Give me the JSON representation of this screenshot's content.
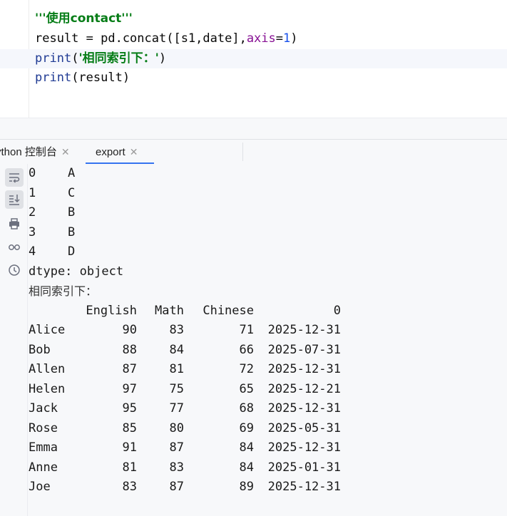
{
  "editor": {
    "lines": [
      {
        "parts": [
          {
            "t": "'''使用contact'''",
            "c": "str"
          }
        ]
      },
      {
        "parts": [
          {
            "t": "result = pd.concat([s1,date],",
            "c": "plain"
          },
          {
            "t": "axis",
            "c": "kw"
          },
          {
            "t": "=",
            "c": "plain"
          },
          {
            "t": "1",
            "c": "num"
          },
          {
            "t": ")",
            "c": "plain"
          }
        ]
      },
      {
        "parts": [
          {
            "t": "print",
            "c": "fn"
          },
          {
            "t": "(",
            "c": "plain"
          },
          {
            "t": "'相同索引下：'",
            "c": "str"
          },
          {
            "t": ")",
            "c": "plain"
          }
        ]
      },
      {
        "parts": [
          {
            "t": "print",
            "c": "fn"
          },
          {
            "t": "(result)",
            "c": "plain"
          }
        ]
      }
    ]
  },
  "tabs": [
    {
      "label": "ython 控制台",
      "active": false
    },
    {
      "label": "export",
      "active": true
    }
  ],
  "toolbar": {
    "icons": [
      "soft-wrap-icon",
      "scroll-to-end-icon",
      "print-icon",
      "glasses-icon",
      "history-icon"
    ]
  },
  "console": {
    "series_lines": [
      {
        "idx": "0",
        "val": "A"
      },
      {
        "idx": "1",
        "val": "C"
      },
      {
        "idx": "2",
        "val": "B"
      },
      {
        "idx": "3",
        "val": "B"
      },
      {
        "idx": "4",
        "val": "D"
      }
    ],
    "dtype_line": "dtype: object",
    "heading": "相同索引下：",
    "columns": [
      "English",
      "Math",
      "Chinese",
      "0"
    ],
    "rows": [
      {
        "name": "Alice",
        "english": "90",
        "math": "83",
        "chinese": "71",
        "date": "2025-12-31"
      },
      {
        "name": "Bob",
        "english": "88",
        "math": "84",
        "chinese": "66",
        "date": "2025-07-31"
      },
      {
        "name": "Allen",
        "english": "87",
        "math": "81",
        "chinese": "72",
        "date": "2025-12-31"
      },
      {
        "name": "Helen",
        "english": "97",
        "math": "75",
        "chinese": "65",
        "date": "2025-12-21"
      },
      {
        "name": "Jack",
        "english": "95",
        "math": "77",
        "chinese": "68",
        "date": "2025-12-31"
      },
      {
        "name": "Rose",
        "english": "85",
        "math": "80",
        "chinese": "69",
        "date": "2025-05-31"
      },
      {
        "name": "Emma",
        "english": "91",
        "math": "87",
        "chinese": "84",
        "date": "2025-12-31"
      },
      {
        "name": "Anne",
        "english": "81",
        "math": "83",
        "chinese": "84",
        "date": "2025-01-31"
      },
      {
        "name": "Joe",
        "english": "83",
        "math": "87",
        "chinese": "89",
        "date": "2025-12-31"
      }
    ]
  }
}
